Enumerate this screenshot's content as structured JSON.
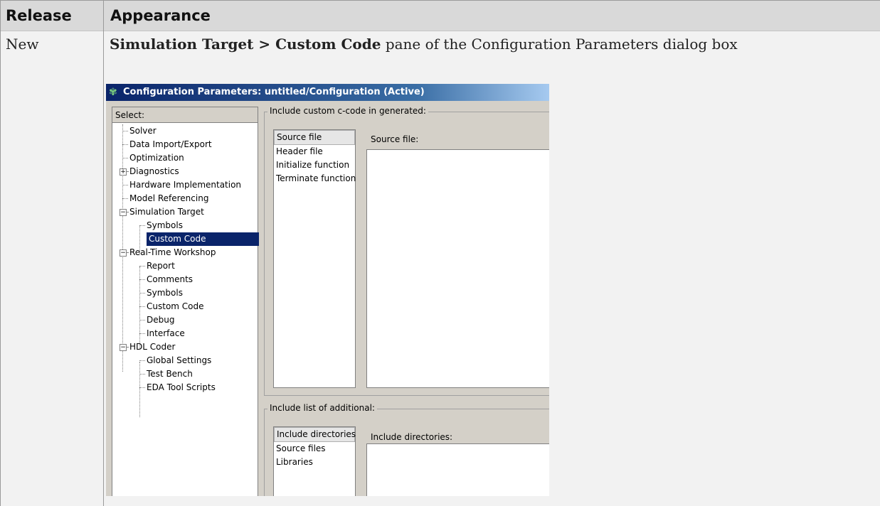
{
  "table": {
    "header_release": "Release",
    "header_appearance": "Appearance",
    "release_value": "New",
    "desc_bold": "Simulation Target > Custom Code",
    "desc_rest": " pane of the Configuration Parameters dialog box"
  },
  "dialog": {
    "title": "Configuration Parameters: untitled/Configuration (Active)",
    "select_label": "Select:",
    "tree": [
      "Solver",
      "Data Import/Export",
      "Optimization",
      "Diagnostics",
      "Hardware Implementation",
      "Model Referencing",
      "Simulation Target",
      "Symbols",
      "Custom Code",
      "Real-Time Workshop",
      "Report",
      "Comments",
      "Symbols",
      "Custom Code",
      "Debug",
      "Interface",
      "HDL Coder",
      "Global Settings",
      "Test Bench",
      "EDA Tool Scripts"
    ],
    "group1": {
      "label": "Include custom c-code in generated:",
      "items": [
        "Source file",
        "Header file",
        "Initialize function",
        "Terminate function"
      ],
      "field_label": "Source file:"
    },
    "group2": {
      "label": "Include list of additional:",
      "items": [
        "Include directories",
        "Source files",
        "Libraries"
      ],
      "field_label": "Include directories:"
    }
  }
}
